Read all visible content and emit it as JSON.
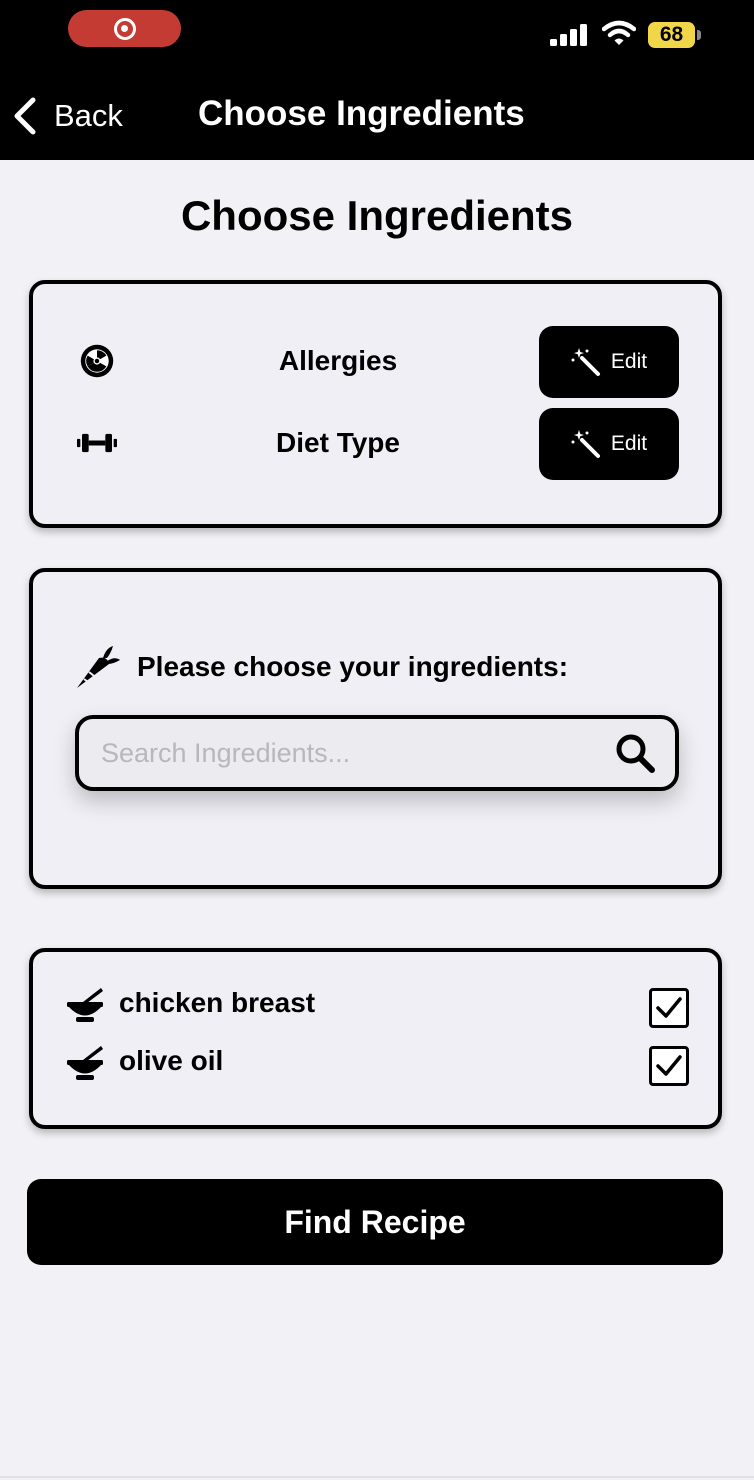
{
  "status_bar": {
    "battery_level": "68",
    "recording_indicator": "record-icon",
    "signal_icon": "cellular-signal-icon",
    "wifi_icon": "wifi-icon"
  },
  "nav": {
    "back_label": "Back",
    "title": "Choose Ingredients"
  },
  "page": {
    "title": "Choose Ingredients"
  },
  "preferences": [
    {
      "icon": "radiation-icon",
      "label": "Allergies",
      "button_label": "Edit"
    },
    {
      "icon": "dumbbell-icon",
      "label": "Diet Type",
      "button_label": "Edit"
    }
  ],
  "ingredient_picker": {
    "icon": "carrot-icon",
    "prompt": "Please choose your ingredients:",
    "search_placeholder": "Search Ingredients...",
    "search_value": ""
  },
  "selected_ingredients": [
    {
      "icon": "mortar-pestle-icon",
      "label": "chicken breast",
      "checked": true
    },
    {
      "icon": "mortar-pestle-icon",
      "label": "olive oil",
      "checked": true
    }
  ],
  "actions": {
    "find_recipe_label": "Find Recipe"
  },
  "colors": {
    "bar_background": "#000000",
    "page_background": "#f2f2f6",
    "recording_pill": "#c33b32",
    "battery": "#f2d64a"
  }
}
